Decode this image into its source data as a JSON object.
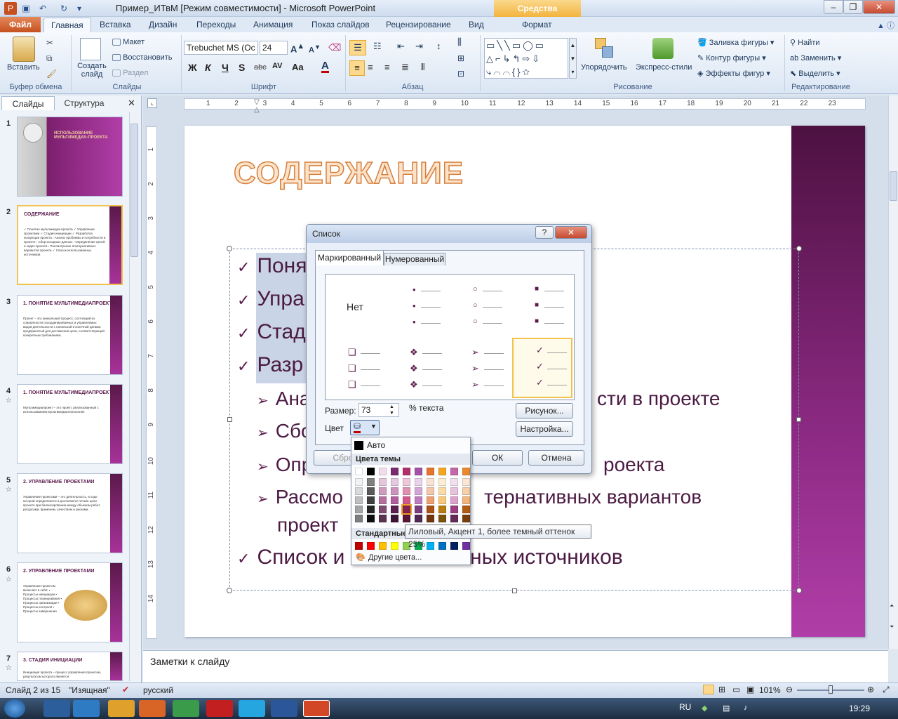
{
  "window": {
    "title": "Пример_ИТвМ [Режим совместимости] - Microsoft PowerPoint",
    "context_tab_title": "Средства рисования"
  },
  "ribbon_tabs": [
    "Файл",
    "Главная",
    "Вставка",
    "Дизайн",
    "Переходы",
    "Анимация",
    "Показ слайдов",
    "Рецензирование",
    "Вид",
    "Формат"
  ],
  "ribbon": {
    "clipboard": {
      "paste": "Вставить",
      "label": "Буфер обмена"
    },
    "slides": {
      "new_slide": "Создать слайд",
      "layout": "Макет",
      "reset": "Восстановить",
      "section": "Раздел",
      "label": "Слайды"
    },
    "font": {
      "name": "Trebuchet MS (Ос",
      "size": "24",
      "label": "Шрифт"
    },
    "paragraph": {
      "label": "Абзац"
    },
    "drawing": {
      "arrange": "Упорядочить",
      "quick_styles": "Экспресс-стили",
      "fill": "Заливка фигуры",
      "outline": "Контур фигуры",
      "effects": "Эффекты фигур",
      "label": "Рисование"
    },
    "editing": {
      "find": "Найти",
      "replace": "Заменить",
      "select": "Выделить",
      "label": "Редактирование"
    }
  },
  "left_panel": {
    "tabs": [
      "Слайды",
      "Структура"
    ],
    "thumbs": [
      {
        "num": "1",
        "title": "ИСПОЛЬЗОВАНИЕ МУЛЬТИМЕДИА-ПРОЕКТА",
        "text": ""
      },
      {
        "num": "2",
        "title": "СОДЕРЖАНИЕ",
        "text": "✓ Понятие мультимедиа-проекта ✓ Управление проектами ✓ Стадия инициации ✓ Разработка концепции проекта › Анализ проблемы и потребности в проекте › Сбор исходных данных › Определение целей и задач проекта › Рассмотрение альтернативных вариантов проекта ✓ Список использованных источников"
      },
      {
        "num": "3",
        "title": "1. ПОНЯТИЕ МУЛЬТИМЕДИАПРОЕКТА",
        "text": "Проект – это уникальный процесс, состоящий из совокупности скоординированных и управляемых видов деятельности с начальной и конечной датами, предпринятый для достижения цели, соответствующей конкретным требованиям."
      },
      {
        "num": "4",
        "title": "1. ПОНЯТИЕ МУЛЬТИМЕДИАПРОЕКТА",
        "text": "Мультимедиапроект – это проект, реализованный с использованием мультимедиатехнологий."
      },
      {
        "num": "5",
        "title": "2. УПРАВЛЕНИЕ ПРОЕКТАМИ",
        "text": "Управление проектами – это деятельность, в ходе которой определяются и достигаются четкие цели проекта при балансировании между объемом работ, ресурсами, временем, качеством и рисками."
      },
      {
        "num": "6",
        "title": "2. УПРАВЛЕНИЕ ПРОЕКТАМИ",
        "text": "Управление проектом включает в себя: ▪ Процессы инициации ▪ Процессы планирования ▪ Процессы организации ▪ Процессы контроля ▪ Процессы завершения"
      },
      {
        "num": "7",
        "title": "3. СТАДИЯ ИНИЦИАЦИИ",
        "text": "Инициация проекта – процесс управления проектом, результатом которого является"
      }
    ]
  },
  "ruler_numbers": [
    "1",
    "2",
    "3",
    "4",
    "5",
    "6",
    "7",
    "8",
    "9",
    "10",
    "11",
    "12",
    "13",
    "14",
    "15",
    "16",
    "17",
    "18",
    "19",
    "20",
    "21",
    "22",
    "23"
  ],
  "ruler_v_numbers": [
    "1",
    "2",
    "3",
    "4",
    "5",
    "6",
    "7",
    "8",
    "9",
    "10",
    "11",
    "12",
    "13",
    "14"
  ],
  "slide": {
    "title": "СОДЕРЖАНИЕ",
    "bullets_l1_top": [
      "Поня",
      "Упра",
      "Стад",
      "Разр"
    ],
    "bullets_l2": [
      {
        "left": "Ана",
        "right": "сти в проекте"
      },
      {
        "left": "Сбо",
        "right": ""
      },
      {
        "left": "Опр",
        "right": "роекта"
      },
      {
        "left": "Рассмо",
        "right": "тернативных вариантов"
      }
    ],
    "bullet_l2_continued": "проект",
    "bullet_last_left": "Список и",
    "bullet_last_right": "ных источников"
  },
  "dialog": {
    "title": "Список",
    "help": "?",
    "close": "✕",
    "tabs": [
      "Маркированный",
      "Нумерованный"
    ],
    "none_label": "Нет",
    "size_label": "Размер:",
    "size_value": "73",
    "size_unit": "% текста",
    "color_label": "Цвет",
    "picture_button": "Рисунок...",
    "customize_button": "Настройка...",
    "reset_button": "Сброс",
    "ok_button": "ОК",
    "cancel_button": "Отмена"
  },
  "color_popup": {
    "auto": "Авто",
    "theme_header": "Цвета темы",
    "standard_header": "Стандартные",
    "more_colors": "Другие цвета...",
    "theme_top": [
      "#ffffff",
      "#000000",
      "#f2dce9",
      "#7a2a6e",
      "#b2306a",
      "#a352a8",
      "#e4742e",
      "#f4a623",
      "#c566a8",
      "#ea8a2e"
    ],
    "theme_columns": [
      [
        "#f2f2f2",
        "#d9d9d9",
        "#bfbfbf",
        "#a6a6a6",
        "#7f7f7f"
      ],
      [
        "#808080",
        "#595959",
        "#404040",
        "#262626",
        "#0d0d0d"
      ],
      [
        "#e6c7da",
        "#d09cbc",
        "#b56f9c",
        "#804b6f",
        "#5a344e"
      ],
      [
        "#e5c8df",
        "#cc93bf",
        "#b15e9f",
        "#5b1f52",
        "#3c1436"
      ],
      [
        "#f0c7d8",
        "#e090b1",
        "#d05989",
        "#85234f",
        "#591734"
      ],
      [
        "#e9d3ea",
        "#d3a7d5",
        "#bd7bc0",
        "#7a3d7e",
        "#512954"
      ],
      [
        "#f9e2d4",
        "#f4c5a9",
        "#ee9f70",
        "#ab5115",
        "#72360e"
      ],
      [
        "#fdedd2",
        "#fbdaa6",
        "#f9c67a",
        "#b97c0f",
        "#7b520a"
      ],
      [
        "#f3e0ee",
        "#e8c1dd",
        "#dca2cc",
        "#9a3e80",
        "#672955"
      ],
      [
        "#fbe7d3",
        "#f7cfa8",
        "#f3b77c",
        "#b35d13",
        "#773e0d"
      ]
    ],
    "standard": [
      "#c00000",
      "#ff0000",
      "#ffc000",
      "#ffff00",
      "#92d050",
      "#00b050",
      "#00b0f0",
      "#0070c0",
      "#002060",
      "#7030a0"
    ],
    "tooltip": "Лиловый, Акцент 1, более темный оттенок 25%"
  },
  "notes_placeholder": "Заметки к слайду",
  "status": {
    "slide": "Слайд 2 из 15",
    "theme": "\"Изящная\"",
    "language": "русский",
    "zoom": "101%"
  },
  "taskbar": {
    "lang": "RU",
    "time": "19:29"
  }
}
